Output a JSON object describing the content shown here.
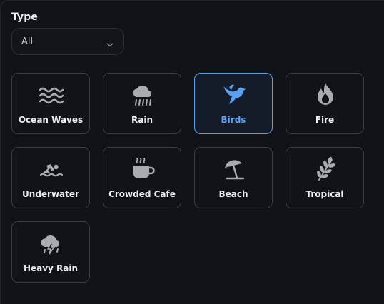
{
  "filter": {
    "label": "Type",
    "selected_value": "All"
  },
  "accent_color": "#5aa0f2",
  "sounds": [
    {
      "label": "Ocean Waves",
      "icon": "waves-icon"
    },
    {
      "label": "Rain",
      "icon": "rain-cloud-icon"
    },
    {
      "label": "Birds",
      "icon": "bird-icon",
      "selected": true
    },
    {
      "label": "Fire",
      "icon": "fire-icon"
    },
    {
      "label": "Underwater",
      "icon": "swimmer-icon"
    },
    {
      "label": "Crowded Cafe",
      "icon": "coffee-cup-icon"
    },
    {
      "label": "Beach",
      "icon": "beach-umbrella-icon"
    },
    {
      "label": "Tropical",
      "icon": "leaf-icon"
    },
    {
      "label": "Heavy Rain",
      "icon": "thunderstorm-icon"
    }
  ]
}
